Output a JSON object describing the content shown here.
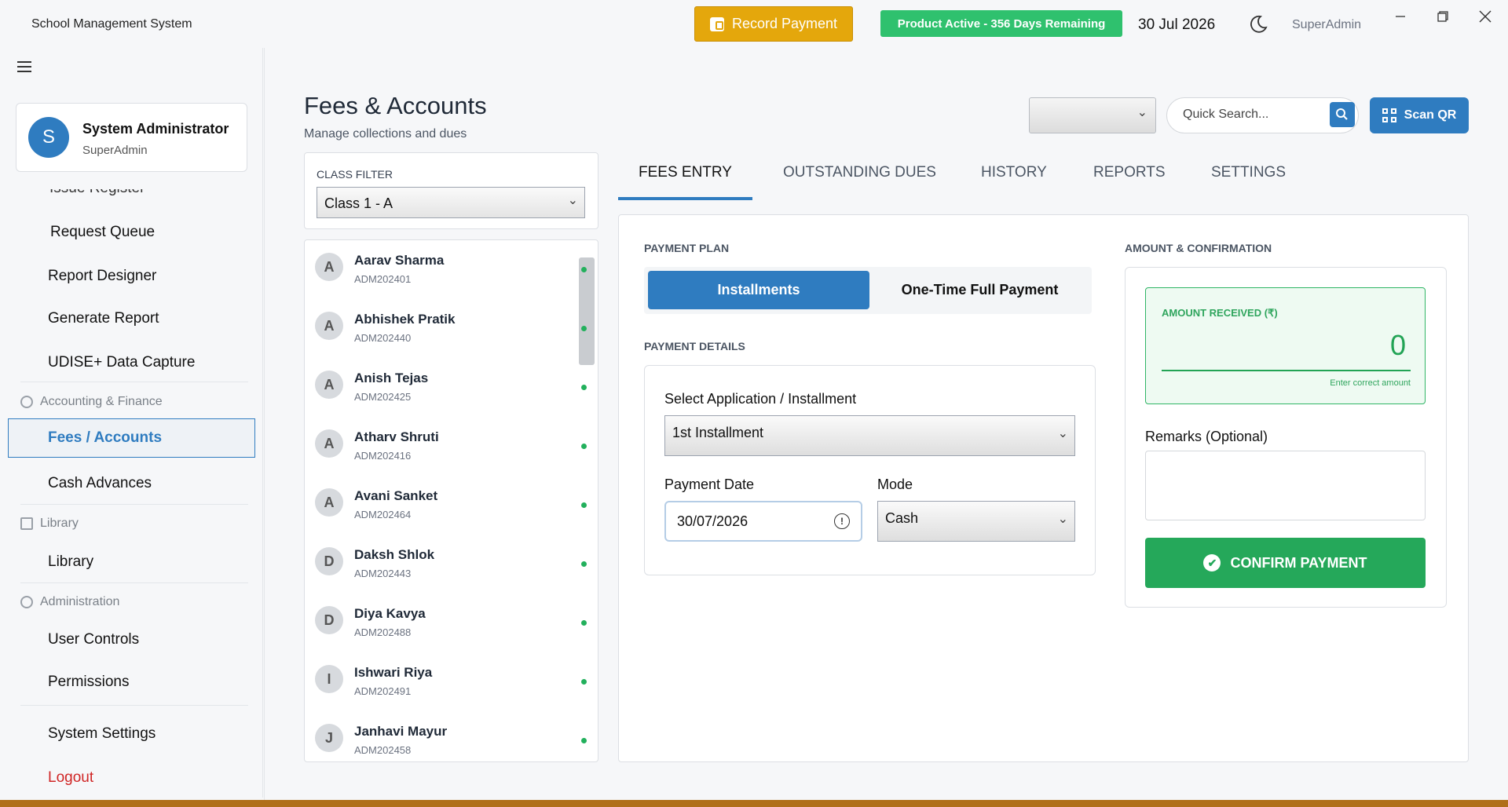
{
  "titlebar": {
    "app_title": "School Management System",
    "record_payment": "Record Payment",
    "product_status": "Product Active - 356 Days Remaining",
    "date": "30 Jul 2026",
    "user": "SuperAdmin"
  },
  "sidebar": {
    "profile": {
      "initial": "S",
      "name": "System Administrator",
      "role": "SuperAdmin"
    },
    "clipped_item": "Issue Register",
    "items": [
      {
        "label": "Request Queue"
      },
      {
        "label": "Report Designer"
      },
      {
        "label": "Generate Report"
      },
      {
        "label": "UDISE+ Data Capture"
      }
    ],
    "sections": {
      "accounting": "Accounting & Finance",
      "library": "Library",
      "administration": "Administration"
    },
    "fees_accounts": "Fees / Accounts",
    "cash_advances": "Cash Advances",
    "library_item": "Library",
    "user_controls": "User Controls",
    "permissions": "Permissions",
    "system_settings": "System Settings",
    "logout": "Logout"
  },
  "header": {
    "title": "Fees & Accounts",
    "subtitle": "Manage collections and dues",
    "search_placeholder": "Quick Search...",
    "scan_qr": "Scan QR"
  },
  "filter": {
    "label": "CLASS FILTER",
    "selected": "Class 1 - A"
  },
  "students": [
    {
      "initial": "A",
      "name": "Aarav Sharma",
      "id": "ADM202401"
    },
    {
      "initial": "A",
      "name": "Abhishek Pratik",
      "id": "ADM202440"
    },
    {
      "initial": "A",
      "name": "Anish Tejas",
      "id": "ADM202425"
    },
    {
      "initial": "A",
      "name": "Atharv Shruti",
      "id": "ADM202416"
    },
    {
      "initial": "A",
      "name": "Avani Sanket",
      "id": "ADM202464"
    },
    {
      "initial": "D",
      "name": "Daksh Shlok",
      "id": "ADM202443"
    },
    {
      "initial": "D",
      "name": "Diya Kavya",
      "id": "ADM202488"
    },
    {
      "initial": "I",
      "name": "Ishwari Riya",
      "id": "ADM202491"
    },
    {
      "initial": "J",
      "name": "Janhavi Mayur",
      "id": "ADM202458"
    }
  ],
  "tabs": [
    {
      "label": "FEES ENTRY",
      "active": true
    },
    {
      "label": "OUTSTANDING DUES",
      "active": false
    },
    {
      "label": "HISTORY",
      "active": false
    },
    {
      "label": "REPORTS",
      "active": false
    },
    {
      "label": "SETTINGS",
      "active": false
    }
  ],
  "form": {
    "payment_plan_title": "PAYMENT PLAN",
    "plan_installments": "Installments",
    "plan_one_time": "One-Time Full Payment",
    "payment_details_title": "PAYMENT DETAILS",
    "installment_label": "Select Application / Installment",
    "installment_value": "1st Installment",
    "date_label": "Payment Date",
    "date_value": "30/07/2026",
    "mode_label": "Mode",
    "mode_value": "Cash",
    "amount_section_title": "AMOUNT & CONFIRMATION",
    "amount_label": "AMOUNT RECEIVED (₹)",
    "amount_value": "0",
    "amount_hint": "Enter correct amount",
    "remarks_label": "Remarks (Optional)",
    "confirm_label": "CONFIRM PAYMENT"
  },
  "colors": {
    "primary": "#2f7cc0",
    "success": "#25a85a",
    "warning": "#e4a70c",
    "danger": "#d02525"
  }
}
